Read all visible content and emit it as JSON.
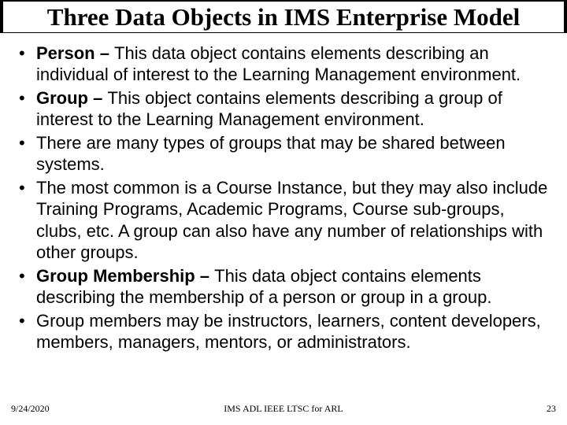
{
  "title": "Three Data Objects in IMS Enterprise Model",
  "bullets": [
    {
      "lead": "Person – ",
      "rest": "This data object contains elements describing an individual of interest to the Learning Management environment."
    },
    {
      "lead": "Group – ",
      "rest": "This object contains elements describing a group of interest to the Learning Management environment."
    },
    {
      "lead": "",
      "rest": "There are many types of groups that may be shared between systems."
    },
    {
      "lead": "",
      "rest": "The most common is a Course Instance, but they may also include Training Programs, Academic Programs, Course sub-groups, clubs, etc. A group can also have any number of relationships with other groups."
    },
    {
      "lead": "Group Membership – ",
      "rest": "This data object contains elements describing the membership of a person or group in a group."
    },
    {
      "lead": "",
      "rest": "Group members may be instructors, learners, content developers, members, managers, mentors, or administrators."
    }
  ],
  "footer": {
    "date": "9/24/2020",
    "center": "IMS ADL IEEE LTSC for ARL",
    "page": "23"
  }
}
